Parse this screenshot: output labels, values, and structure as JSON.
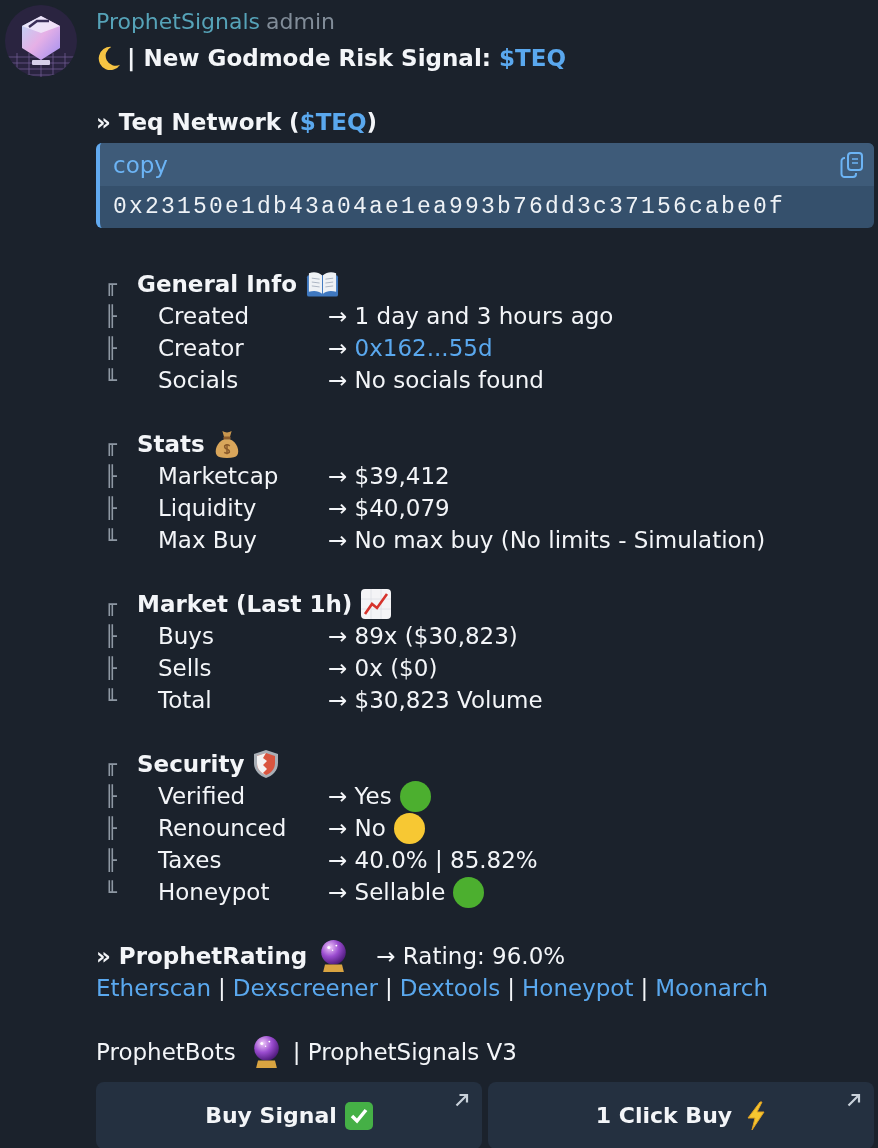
{
  "author": {
    "name": "ProphetSignals",
    "role": "admin"
  },
  "headline": {
    "text": "| New Godmode Risk Signal:",
    "ticker": "$TEQ"
  },
  "token": {
    "prefix": "» Teq Network (",
    "ticker": "$TEQ",
    "suffix": ")"
  },
  "code_block": {
    "label": "copy",
    "value": "0x23150e1db43a04ae1ea993b76dd3c37156cabe0f"
  },
  "sections": [
    {
      "branch": "╓",
      "title": "General Info",
      "rows": [
        {
          "kind": "text",
          "branch": "╟",
          "label": "Created",
          "value": "→ 1 day and 3 hours ago"
        },
        {
          "kind": "link",
          "branch": "╟",
          "label": "Creator",
          "value": "→",
          "link": "0x162...55d"
        },
        {
          "kind": "text",
          "branch": "╙",
          "label": "Socials",
          "value": "→ No socials found"
        }
      ]
    },
    {
      "branch": "╓",
      "title": "Stats",
      "rows": [
        {
          "kind": "text",
          "branch": "╟",
          "label": "Marketcap",
          "value": "→ $39,412"
        },
        {
          "kind": "text",
          "branch": "╟",
          "label": "Liquidity",
          "value": "→ $40,079"
        },
        {
          "kind": "text",
          "branch": "╙",
          "label": "Max Buy",
          "value": "→ No max buy (No limits - Simulation)"
        }
      ]
    },
    {
      "branch": "╓",
      "title": "Market (Last 1h)",
      "rows": [
        {
          "kind": "text",
          "branch": "╟",
          "label": "Buys",
          "value": "→ 89x ($30,823)"
        },
        {
          "kind": "text",
          "branch": "╟",
          "label": "Sells",
          "value": "→ 0x ($0)"
        },
        {
          "kind": "text",
          "branch": "╙",
          "label": "Total",
          "value": "→ $30,823 Volume"
        }
      ]
    },
    {
      "branch": "╓",
      "title": "Security",
      "rows": [
        {
          "kind": "status",
          "branch": "╟",
          "label": "Verified",
          "value": "→ Yes",
          "color": "#4caf2f"
        },
        {
          "kind": "status",
          "branch": "╟",
          "label": "Renounced",
          "value": "→ No",
          "color": "#f7c833"
        },
        {
          "kind": "text",
          "branch": "╟",
          "label": "Taxes",
          "value": "→ 40.0% | 85.82%"
        },
        {
          "kind": "status",
          "branch": "╙",
          "label": "Honeypot",
          "value": "→ Sellable",
          "color": "#4caf2f"
        }
      ]
    }
  ],
  "rating": {
    "title": "» ProphetRating",
    "value": "→ Rating: 96.0%"
  },
  "links": [
    {
      "label": "Etherscan",
      "separator": "|"
    },
    {
      "label": "Dexscreener",
      "separator": "|"
    },
    {
      "label": "Dextools",
      "separator": "|"
    },
    {
      "label": "Honeypot",
      "separator": "|"
    },
    {
      "label": "Moonarch"
    }
  ],
  "footer": {
    "brand": "ProphetBots",
    "text": "| ProphetSignals V3"
  },
  "buttons": [
    {
      "label": "Buy Signal"
    },
    {
      "label": "1 Click Buy"
    }
  ]
}
